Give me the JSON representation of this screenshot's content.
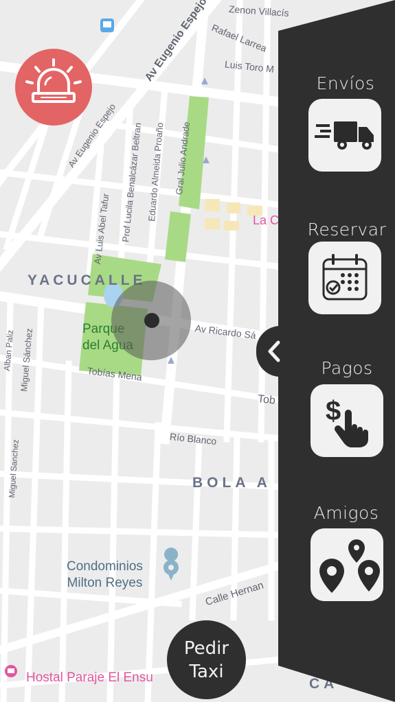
{
  "map": {
    "streets": [
      "Zenon Villacís",
      "Rafael Larrea",
      "Luis Toro M",
      "Av Eugenio Espejo",
      "Av Eugenio Espejo",
      "Prof Lucila Benalcázar Beltran",
      "Eduardo Almeida Proaño",
      "Gral Julio Andrade",
      "Av Luis Abel Tafur",
      "Av Ricardo Sá",
      "Tobías Mena",
      "Tob",
      "Río Blanco",
      "Calle Hernan",
      "Miguel Sánchez",
      "Miguel Sanchez",
      "Alban Paliz",
      "Miguel Sanchez"
    ],
    "neighborhoods": [
      "YACUCALLE",
      "BOLA A",
      "CA"
    ],
    "places": {
      "park": "Parque del Agua",
      "park_line1": "Parque",
      "park_line2": "del Agua",
      "condo_line1": "Condominios",
      "condo_line2": "Milton Reyes",
      "hostal": "Hostal Paraje El Ensu",
      "poi_pink": "La C"
    }
  },
  "menu": [
    {
      "label": "Envíos",
      "icon": "delivery-truck-icon"
    },
    {
      "label": "Reservar",
      "icon": "calendar-icon"
    },
    {
      "label": "Pagos",
      "icon": "payment-hand-icon"
    },
    {
      "label": "Amigos",
      "icon": "location-pins-icon"
    }
  ],
  "actions": {
    "pedir_line1": "Pedir",
    "pedir_line2": "Taxi"
  },
  "colors": {
    "alarm": "#e36464",
    "panel": "#2f2f2f",
    "park": "#a8da86",
    "map_bg": "#ececec",
    "poi_pink": "#e0579f"
  }
}
